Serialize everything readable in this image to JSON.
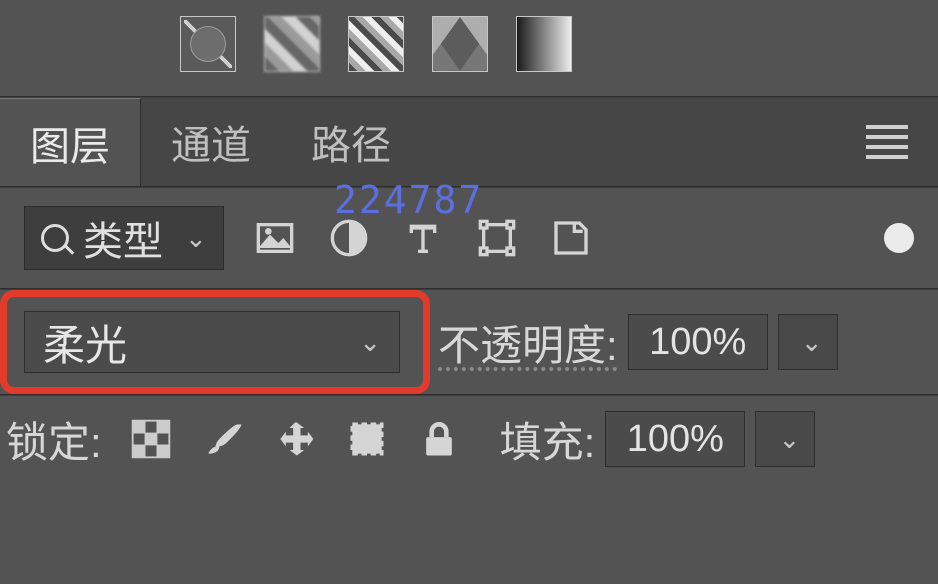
{
  "tabs": {
    "layers": "图层",
    "channels": "通道",
    "paths": "路径"
  },
  "filter": {
    "type_label": "类型"
  },
  "blend": {
    "mode": "柔光",
    "opacity_label": "不透明度:",
    "opacity_value": "100%"
  },
  "lock": {
    "label": "锁定:",
    "fill_label": "填充:",
    "fill_value": "100%"
  },
  "watermark": "224787"
}
